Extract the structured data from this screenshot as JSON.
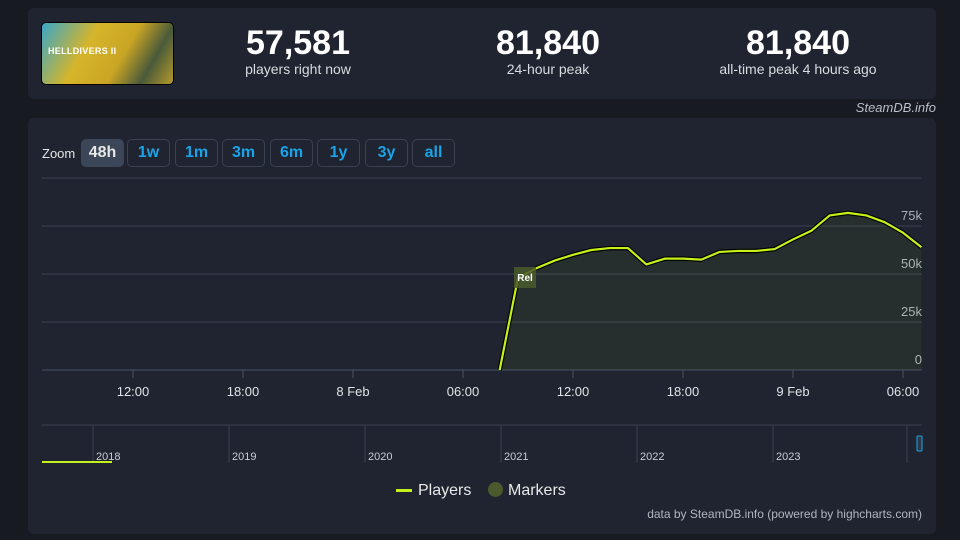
{
  "header": {
    "game_image_text": "HELLDIVERS II",
    "stats": [
      {
        "value": "57,581",
        "label": "players right now"
      },
      {
        "value": "81,840",
        "label": "24-hour peak"
      },
      {
        "value": "81,840",
        "label": "all-time peak 4 hours ago"
      }
    ],
    "credit": "SteamDB.info"
  },
  "zoom": {
    "label": "Zoom",
    "buttons": [
      "48h",
      "1w",
      "1m",
      "3m",
      "6m",
      "1y",
      "3y",
      "all"
    ],
    "active": "48h"
  },
  "chart_data": {
    "type": "line",
    "xlabel": "",
    "ylabel": "",
    "x_ticks": [
      "12:00",
      "18:00",
      "8 Feb",
      "06:00",
      "12:00",
      "18:00",
      "9 Feb",
      "06:00"
    ],
    "y_ticks": [
      "0",
      "25k",
      "50k",
      "75k"
    ],
    "ylim": [
      0,
      100000
    ],
    "grid": true,
    "series": [
      {
        "name": "Players",
        "color": "#c5f11b",
        "x": [
          "8 Feb 08:00",
          "8 Feb 09:00",
          "8 Feb 10:00",
          "8 Feb 11:00",
          "8 Feb 12:00",
          "8 Feb 13:00",
          "8 Feb 14:00",
          "8 Feb 15:00",
          "8 Feb 16:00",
          "8 Feb 17:00",
          "8 Feb 18:00",
          "8 Feb 19:00",
          "8 Feb 20:00",
          "8 Feb 21:00",
          "8 Feb 22:00",
          "8 Feb 23:00",
          "9 Feb 00:00",
          "9 Feb 01:00",
          "9 Feb 02:00",
          "9 Feb 03:00",
          "9 Feb 04:00",
          "9 Feb 05:00",
          "9 Feb 06:00",
          "9 Feb 07:00"
        ],
        "values": [
          0,
          48000,
          53000,
          57000,
          60000,
          62500,
          63500,
          63500,
          55000,
          58000,
          58000,
          57500,
          61500,
          62000,
          62000,
          63000,
          68000,
          72500,
          80500,
          81840,
          80500,
          77000,
          71500,
          64000
        ]
      }
    ],
    "markers": [
      {
        "label": "Rel",
        "x": "8 Feb 09:00",
        "color": "#4a5a2c"
      }
    ],
    "navigator_years": [
      "2018",
      "2019",
      "2020",
      "2021",
      "2022",
      "2023"
    ],
    "legend": [
      {
        "name": "Players",
        "color": "#c5f11b"
      },
      {
        "name": "Markers",
        "color": "#4a5a2c"
      }
    ],
    "legend_position": "bottom"
  },
  "footer": "data by SteamDB.info (powered by highcharts.com)"
}
